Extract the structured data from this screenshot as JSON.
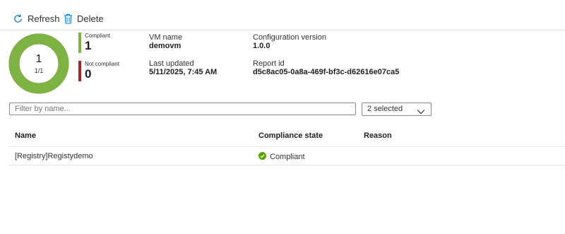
{
  "toolbar": {
    "refresh_label": "Refresh",
    "refresh_icon": "refresh-icon",
    "delete_label": "Delete",
    "delete_icon": "trash-icon",
    "accent": "#0078d4"
  },
  "summary": {
    "donut": {
      "count": "1",
      "ratio": "1/1",
      "compliant_fraction": 1.0,
      "compliant_color": "#7cb342",
      "noncompliant_color": "#a4262c"
    },
    "compliant": {
      "label": "Compliant",
      "value": "1"
    },
    "not_compliant": {
      "label": "Not compliant",
      "value": "0"
    }
  },
  "properties": {
    "vm_name": {
      "label": "VM name",
      "value": "demovm"
    },
    "configuration_version": {
      "label": "Configuration version",
      "value": "1.0.0"
    },
    "last_updated": {
      "label": "Last updated",
      "value": "5/11/2025, 7:45 AM"
    },
    "report_id": {
      "label": "Report id",
      "value": "d5c8ac05-0a8a-469f-bf3c-d62616e07ca5"
    }
  },
  "filter": {
    "placeholder": "Filter by name...",
    "value": ""
  },
  "status_filter": {
    "selected": "2 selected",
    "icon": "chevron-down-icon"
  },
  "table": {
    "columns": [
      "Name",
      "Compliance state",
      "Reason"
    ],
    "rows": [
      {
        "name": "[Registry]Registydemo",
        "state": "Compliant",
        "state_icon": "check-circle-icon",
        "reason": ""
      }
    ]
  }
}
